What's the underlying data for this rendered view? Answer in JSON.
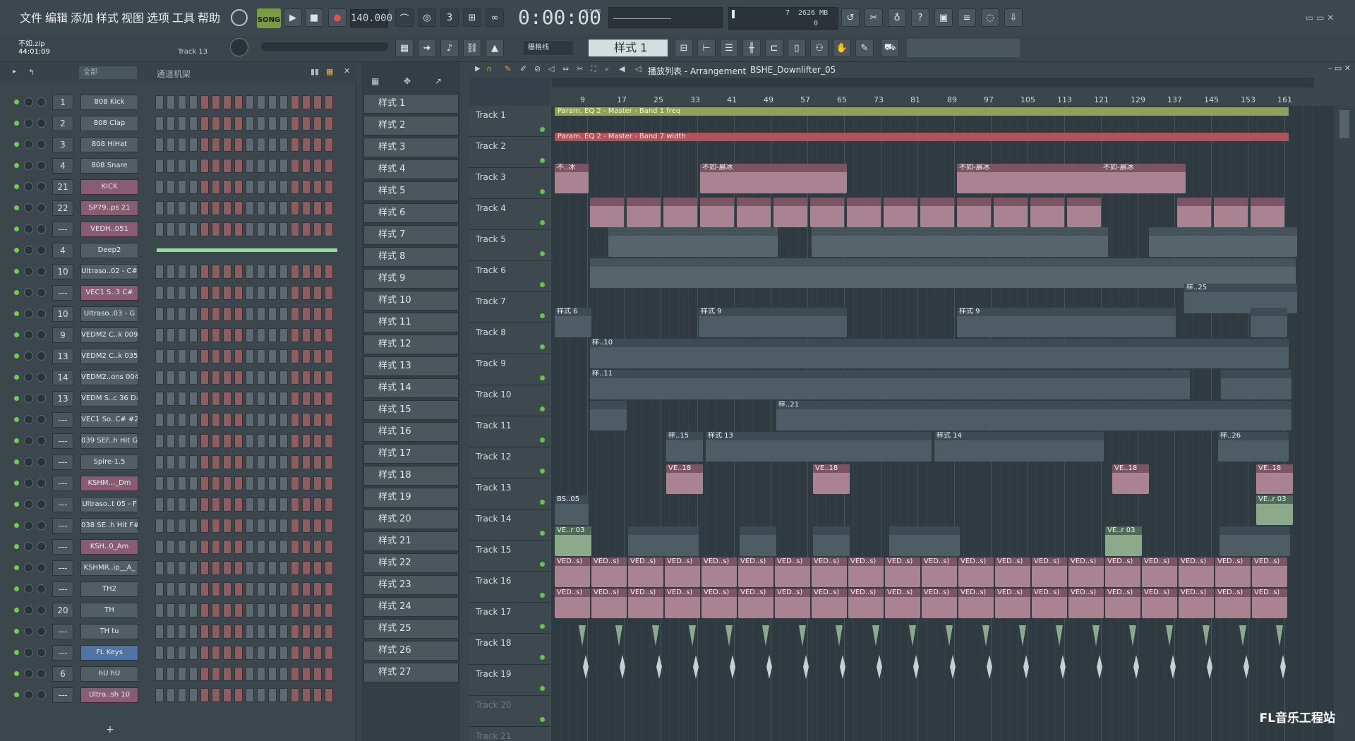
{
  "menu": [
    "文件",
    "编辑",
    "添加",
    "样式",
    "视图",
    "选项",
    "工具",
    "帮助"
  ],
  "transport": {
    "mode": "SONG",
    "tempo": "140.000",
    "time": "0:00:00",
    "time_label": "M:S:CS",
    "memory": "2626 MB",
    "cpu_top": "7",
    "cpu_bottom": "0"
  },
  "project": {
    "file": "不如.zip",
    "time": "44:01:09",
    "track_hint": "Track 13"
  },
  "pattern_select": {
    "label": "样式 1",
    "snap": "栅格线"
  },
  "rack": {
    "filter": "全部",
    "title": "通道机架",
    "channels": [
      {
        "num": "1",
        "name": "808 Kick",
        "style": "gray"
      },
      {
        "num": "2",
        "name": "808 Clap",
        "style": "gray"
      },
      {
        "num": "3",
        "name": "808 HiHat",
        "style": "gray"
      },
      {
        "num": "4",
        "name": "808 Snare",
        "style": "gray"
      },
      {
        "num": "21",
        "name": "KICK",
        "style": "pink"
      },
      {
        "num": "22",
        "name": "SP79..ps 21",
        "style": "pink"
      },
      {
        "num": "---",
        "name": "VEDH..051",
        "style": "pink"
      },
      {
        "num": "4",
        "name": "Deep2",
        "style": "gray"
      },
      {
        "num": "10",
        "name": "Ultraso..02 - C#",
        "style": "gray"
      },
      {
        "num": "---",
        "name": "VEC1 S..3 C#",
        "style": "pink"
      },
      {
        "num": "10",
        "name": "Ultraso..03 - G",
        "style": "gray"
      },
      {
        "num": "9",
        "name": "VEDM2 C..k 009",
        "style": "gray"
      },
      {
        "num": "13",
        "name": "VEDM2 C..k 035",
        "style": "gray"
      },
      {
        "num": "14",
        "name": "VEDM2..ons 004",
        "style": "gray"
      },
      {
        "num": "13",
        "name": "VEDM S..c 36 D#",
        "style": "gray"
      },
      {
        "num": "---",
        "name": "VEC1 So..C# #2",
        "style": "gray"
      },
      {
        "num": "---",
        "name": "039 SEF..h Hit G",
        "style": "gray"
      },
      {
        "num": "---",
        "name": "Spire-1.5",
        "style": "gray"
      },
      {
        "num": "---",
        "name": "KSHM..._Dm",
        "style": "pink"
      },
      {
        "num": "---",
        "name": "Ultraso..t 05 - F",
        "style": "gray"
      },
      {
        "num": "---",
        "name": "038 SE..h Hit F#",
        "style": "gray"
      },
      {
        "num": "---",
        "name": "KSH..0_Am",
        "style": "pink"
      },
      {
        "num": "---",
        "name": "KSHMR..ip__A_",
        "style": "gray"
      },
      {
        "num": "---",
        "name": "TH2",
        "style": "gray"
      },
      {
        "num": "20",
        "name": "TH",
        "style": "gray"
      },
      {
        "num": "---",
        "name": "TH tu",
        "style": "gray"
      },
      {
        "num": "---",
        "name": "FL Keys",
        "style": "blue"
      },
      {
        "num": "6",
        "name": "hU hU",
        "style": "gray"
      },
      {
        "num": "---",
        "name": "Ultra..sh 10",
        "style": "pink"
      }
    ]
  },
  "patterns": [
    "样式 1",
    "样式 2",
    "样式 3",
    "样式 4",
    "样式 5",
    "样式 6",
    "样式 7",
    "样式 8",
    "样式 9",
    "样式 10",
    "样式 11",
    "样式 12",
    "样式 13",
    "样式 14",
    "样式 15",
    "样式 16",
    "样式 17",
    "样式 18",
    "样式 19",
    "样式 20",
    "样式 21",
    "样式 22",
    "样式 23",
    "样式 24",
    "样式 25",
    "样式 26",
    "样式 27"
  ],
  "playlist": {
    "title": "播放列表 - Arrangement",
    "breadcrumb": "BSHE_Downlifter_05",
    "ruler": [
      "9",
      "17",
      "25",
      "33",
      "41",
      "49",
      "57",
      "65",
      "73",
      "81",
      "89",
      "97",
      "105",
      "113",
      "121",
      "129",
      "137",
      "145",
      "153",
      "161"
    ],
    "tracks": [
      "Track 1",
      "Track 2",
      "Track 3",
      "Track 4",
      "Track 5",
      "Track 6",
      "Track 7",
      "Track 8",
      "Track 9",
      "Track 10",
      "Track 11",
      "Track 12",
      "Track 13",
      "Track 14",
      "Track 15",
      "Track 16",
      "Track 17",
      "Track 18",
      "Track 19",
      "Track 20",
      "Track 21"
    ],
    "auto1": "Param. EQ 2 - Master - Band 1 freq",
    "auto2": "Param. EQ 2 - Master - Band 7 width",
    "clip_labels": {
      "t3a": "不..冰",
      "t3b": "不如-晨冰",
      "t3c": "不如-晨冰",
      "t3d": "不如-晨冰",
      "t7": "样..25",
      "t8": "样式 6",
      "t8b": "样式 9",
      "t9": "样..10",
      "t10": "样..11",
      "t11": "样..21",
      "t12a": "样..15",
      "t12b": "样式 13",
      "t12c": "样式 14",
      "t12d": "样..26",
      "t13": "VE..18",
      "t14": "BS..05",
      "t14b": "VE..r 03",
      "t15": "VE..r 03",
      "t16": "VED..s)"
    }
  },
  "watermark": "FL音乐工程站"
}
